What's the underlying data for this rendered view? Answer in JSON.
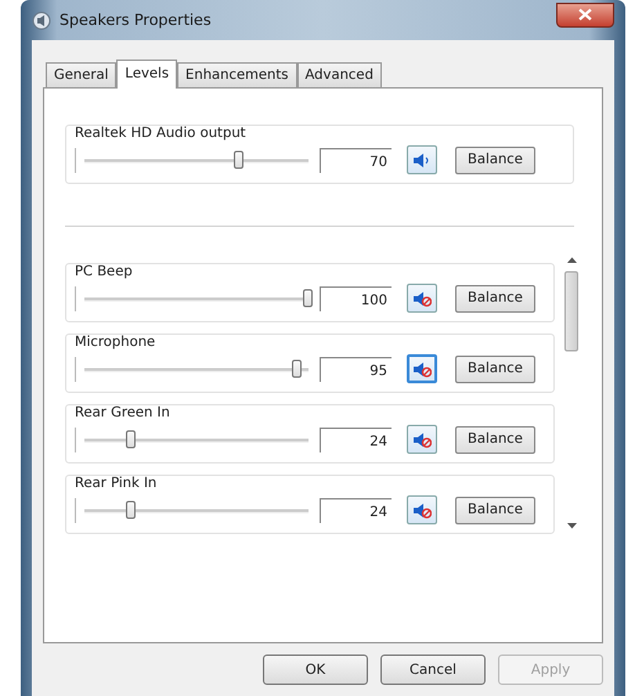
{
  "window": {
    "title": "Speakers Properties"
  },
  "tabs": [
    {
      "label": "General",
      "selected": false
    },
    {
      "label": "Levels",
      "selected": true
    },
    {
      "label": "Enhancements",
      "selected": false
    },
    {
      "label": "Advanced",
      "selected": false
    }
  ],
  "master": {
    "name": "Realtek HD Audio output",
    "level": 0.7,
    "value": "70",
    "muted": false,
    "balance": "Balance"
  },
  "channels": [
    {
      "name": "PC Beep",
      "level": 1.0,
      "value": "100",
      "muted": true,
      "focused": false,
      "balance": "Balance"
    },
    {
      "name": "Microphone",
      "level": 0.95,
      "value": "95",
      "muted": true,
      "focused": true,
      "balance": "Balance"
    },
    {
      "name": "Rear Green In",
      "level": 0.24,
      "value": "24",
      "muted": true,
      "focused": false,
      "balance": "Balance"
    },
    {
      "name": "Rear Pink In",
      "level": 0.24,
      "value": "24",
      "muted": true,
      "focused": false,
      "balance": "Balance"
    }
  ],
  "buttons": [
    {
      "label": "OK",
      "disabled": false
    },
    {
      "label": "Cancel",
      "disabled": false
    },
    {
      "label": "Apply",
      "disabled": true
    }
  ]
}
